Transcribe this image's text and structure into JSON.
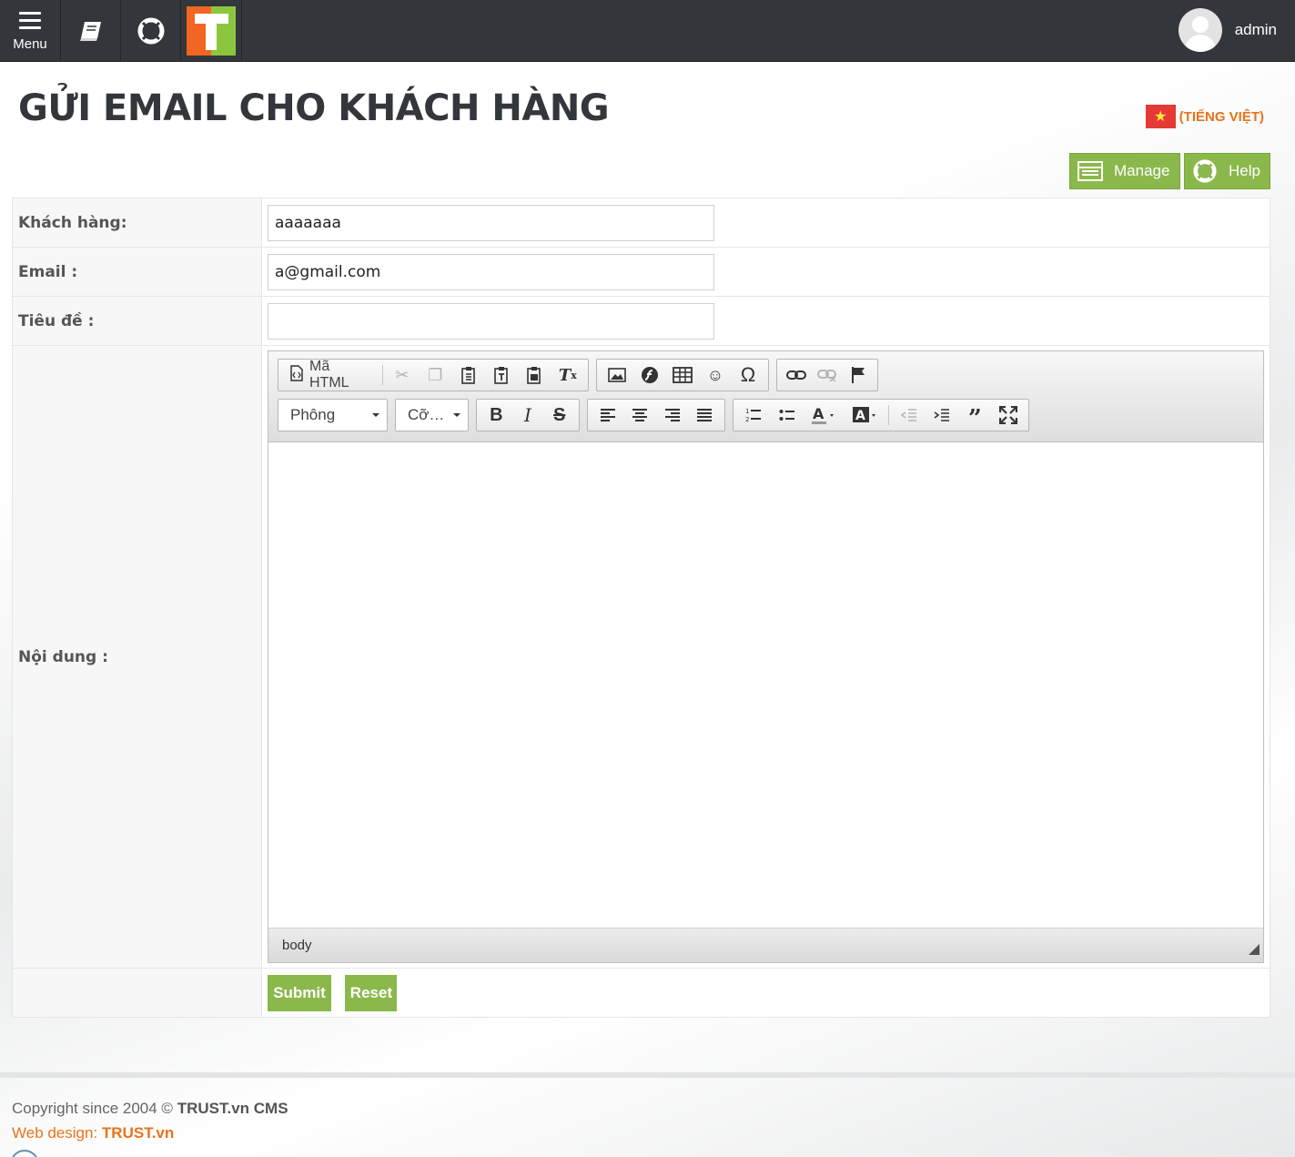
{
  "topbar": {
    "menu_label": "Menu",
    "icons": [
      "menu-icon",
      "book-icon",
      "lifebuoy-icon",
      "trust-logo"
    ],
    "logo_letter": "T",
    "username": "admin"
  },
  "page": {
    "title": "GỬI EMAIL CHO KHÁCH HÀNG",
    "language_label": "(TIẾNG VIỆT)",
    "actions": {
      "manage": "Manage",
      "help": "Help"
    }
  },
  "form": {
    "customer_label": "Khách hàng:",
    "customer_value": "aaaaaaa",
    "email_label": "Email :",
    "email_value": "a@gmail.com",
    "subject_label": "Tiêu đề :",
    "subject_value": "",
    "content_label": "Nội dung :",
    "submit_label": "Submit",
    "reset_label": "Reset"
  },
  "editor": {
    "source_label": "Mã HTML",
    "font_combo": "Phông",
    "size_combo": "Cỡ…",
    "status_path": "body"
  },
  "footer": {
    "copyright_prefix": "Copyright since 2004 © ",
    "copyright_brand": "TRUST.vn CMS",
    "design_prefix": "Web design: ",
    "design_brand": "TRUST.vn"
  },
  "colors": {
    "topbar": "#33363b",
    "accent_green": "#8bb84b",
    "accent_orange": "#e9731c",
    "logo_orange": "#f26522",
    "logo_green": "#8cc63f"
  }
}
